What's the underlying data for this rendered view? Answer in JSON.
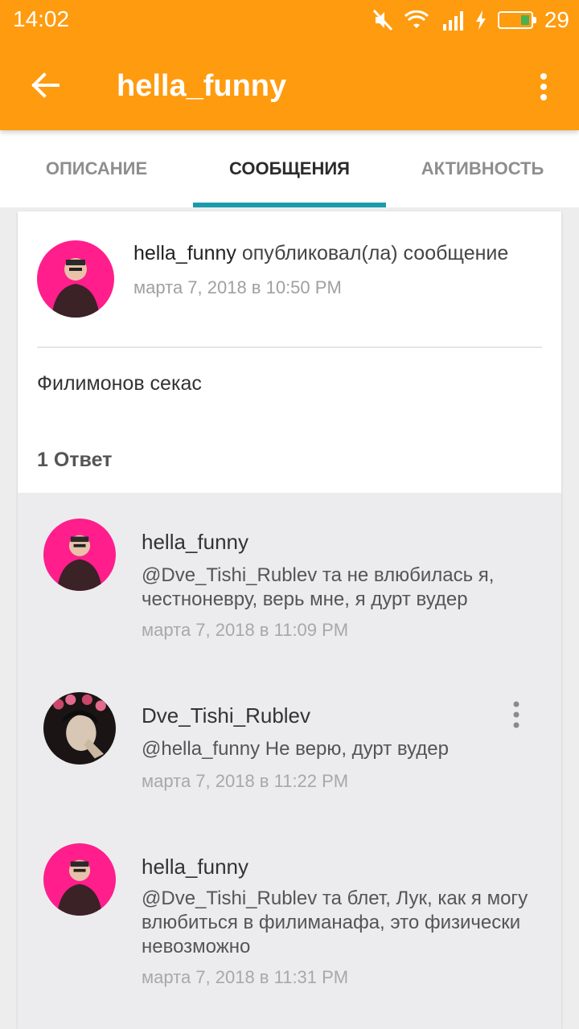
{
  "status_bar": {
    "time": "14:02",
    "battery": "29"
  },
  "app_bar": {
    "title": "hella_funny"
  },
  "tabs": [
    {
      "label": "ОПИСАНИЕ",
      "active": false
    },
    {
      "label": "СООБЩЕНИЯ",
      "active": true
    },
    {
      "label": "АКТИВНОСТЬ",
      "active": false
    }
  ],
  "post": {
    "author": "hella_funny",
    "action": "опубликовал(ла) сообщение",
    "date": "марта 7, 2018 в 10:50 PM",
    "body": "Филимонов секас",
    "reply_count": "1 Ответ"
  },
  "replies": [
    {
      "author": "hella_funny",
      "text": "@Dve_Tishi_Rublev  та не влюбилась я, честноневру, верь мне, я дурт вудер",
      "date": "марта 7, 2018 в 11:09 PM"
    },
    {
      "author": "Dve_Tishi_Rublev",
      "text": "@hella_funny Не верю, дурт вудер",
      "date": "марта 7, 2018 в 11:22 PM"
    },
    {
      "author": "hella_funny",
      "text": "@Dve_Tishi_Rublev  та блет, Лук, как я могу влюбиться в филиманафа, это физически невозможно",
      "date": "марта 7, 2018 в 11:31 PM"
    }
  ],
  "colors": {
    "app_bar": "#ff9b0f",
    "tab_indicator": "#1a9bab",
    "avatar_pink": "#ff1e8c"
  }
}
